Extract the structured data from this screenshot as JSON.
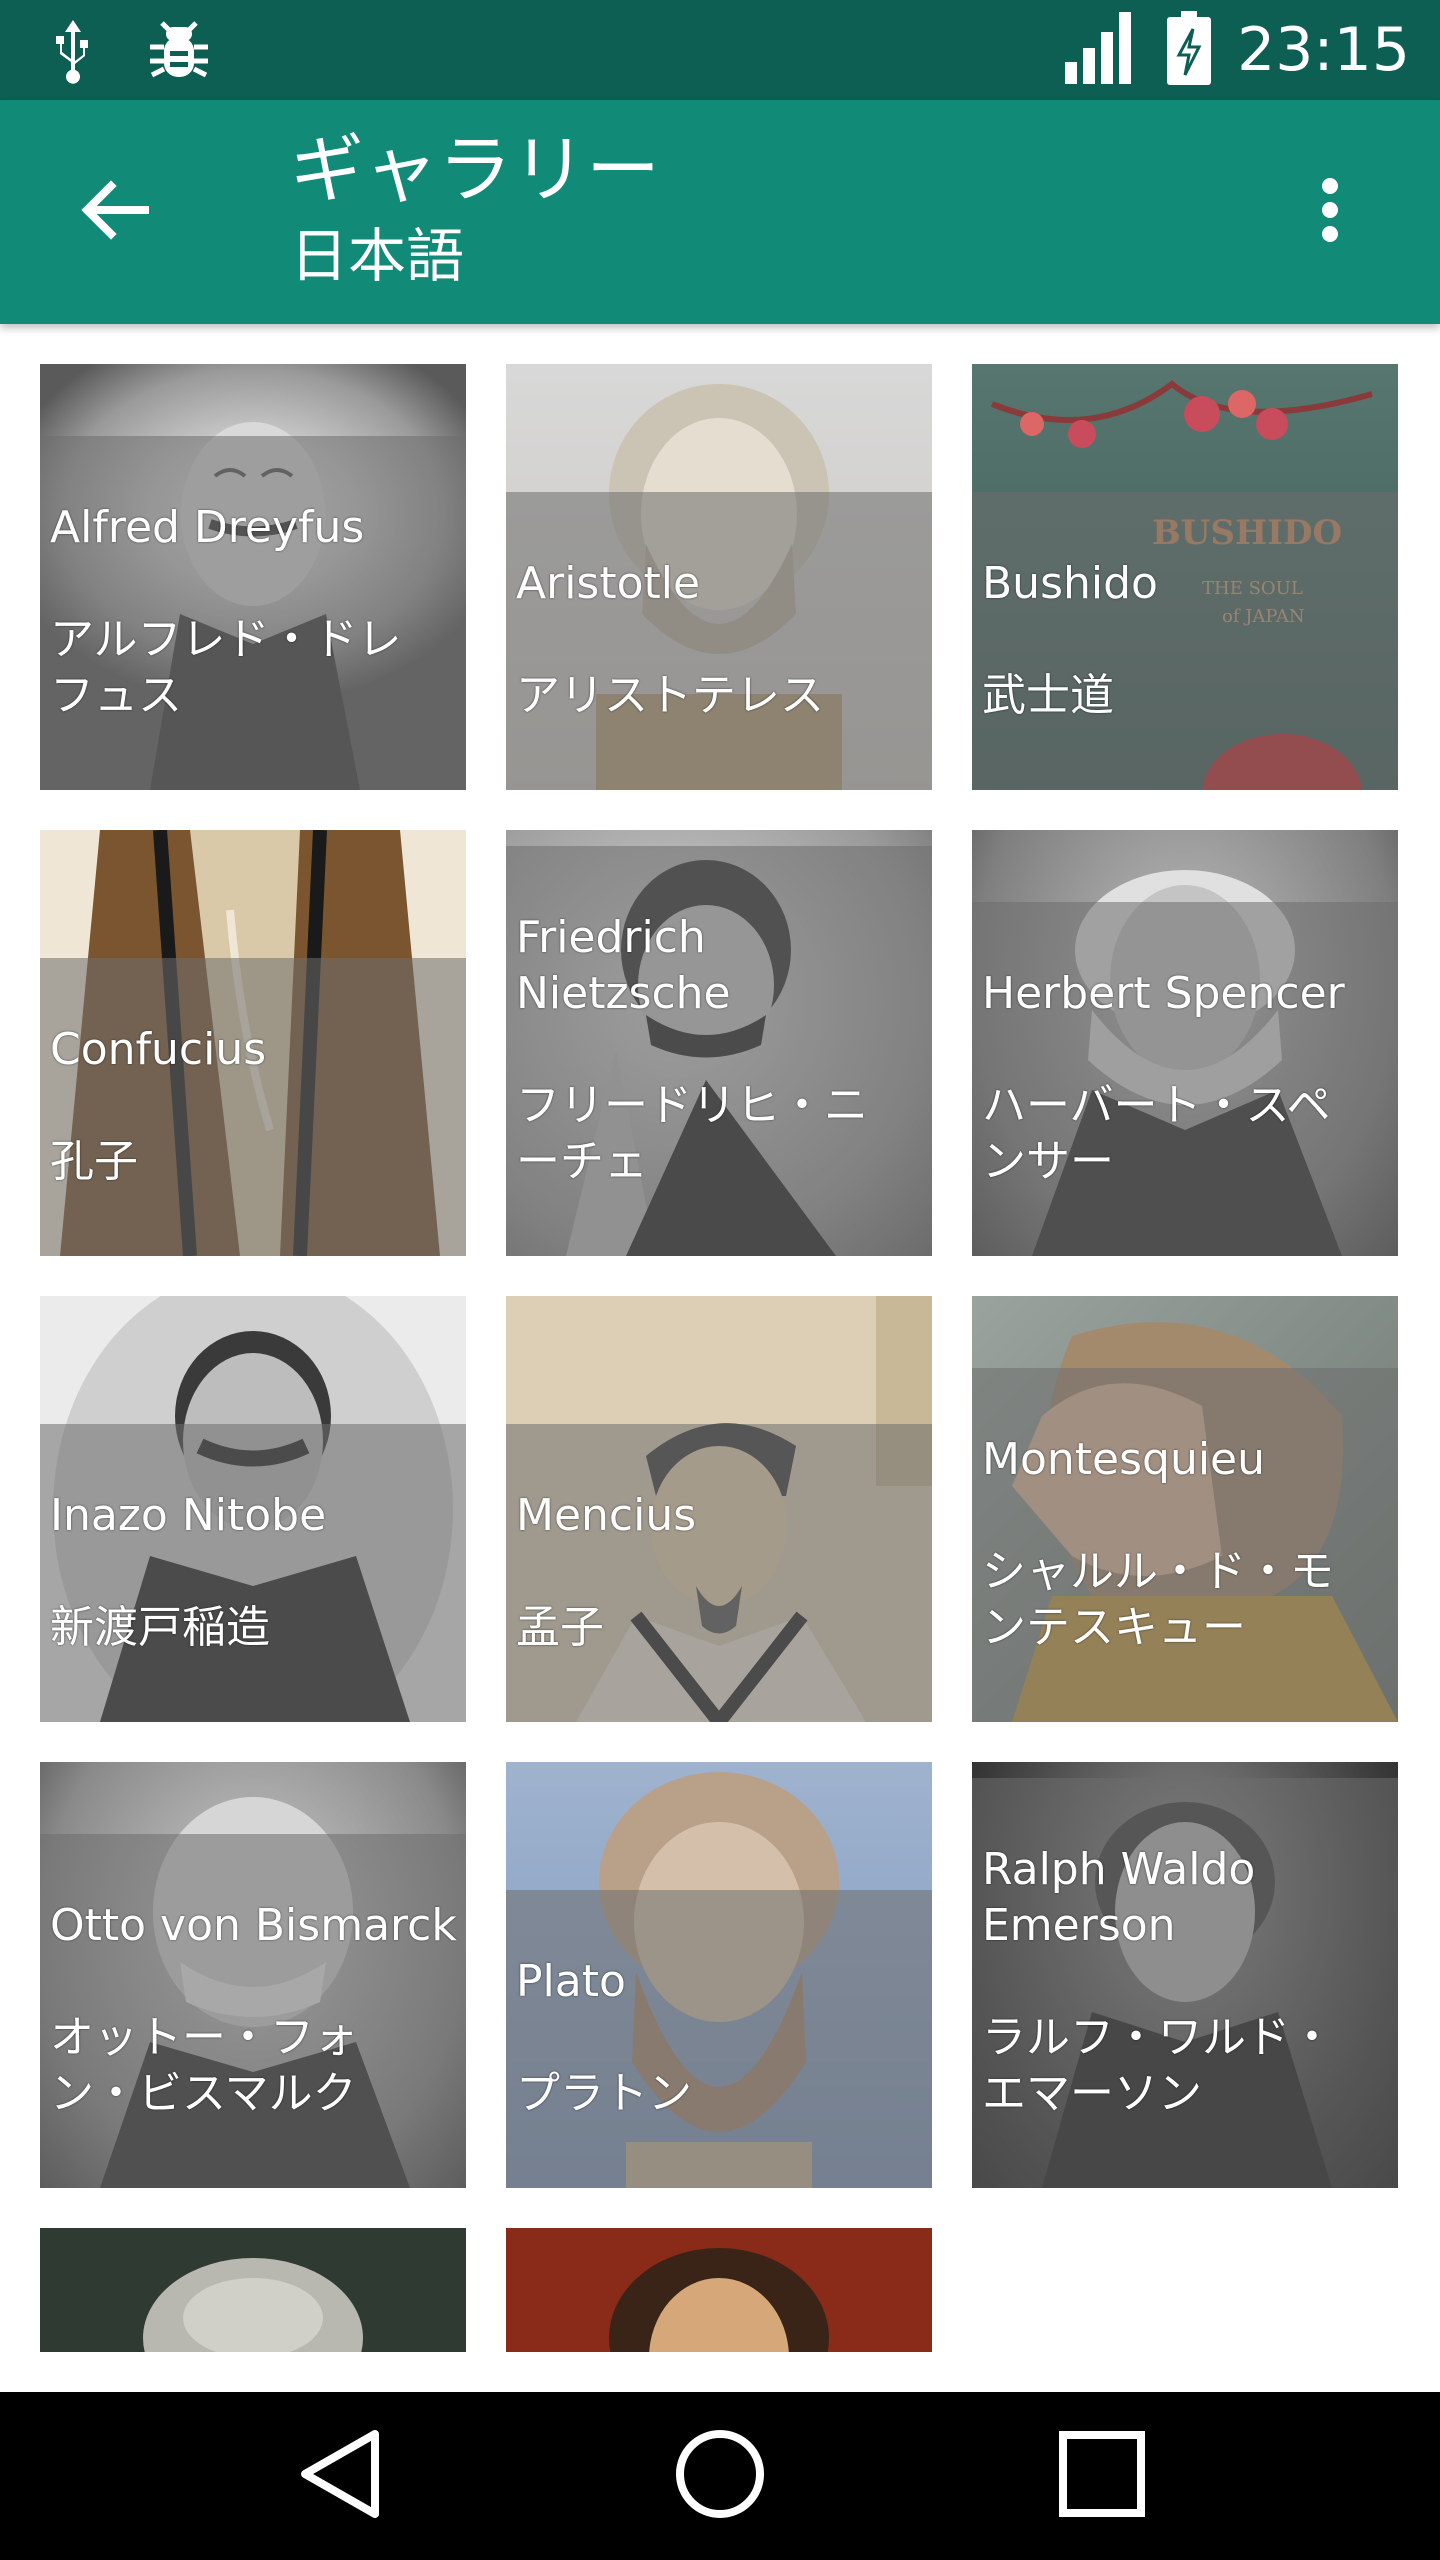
{
  "status_bar": {
    "time": "23:15",
    "left_icons": [
      "usb-icon",
      "bug-icon"
    ],
    "right_icons": [
      "signal-icon",
      "battery-charging-icon"
    ]
  },
  "app_bar": {
    "title": "ギャラリー",
    "subtitle": "日本語",
    "back_icon": "arrow-back-icon",
    "menu_icon": "more-vert-icon"
  },
  "gallery": {
    "items": [
      {
        "name_en": "Alfred Dreyfus",
        "name_ja": "アルフレド・ドレ\nフュス"
      },
      {
        "name_en": "Aristotle",
        "name_ja": "アリストテレス"
      },
      {
        "name_en": "Bushido",
        "name_ja": "武士道"
      },
      {
        "name_en": "Confucius",
        "name_ja": "孔子"
      },
      {
        "name_en": "Friedrich Nietzsche",
        "name_ja": "フリードリヒ・ニ\nーチェ"
      },
      {
        "name_en": "Herbert Spencer",
        "name_ja": "ハーバート・スペ\nンサー"
      },
      {
        "name_en": "Inazo Nitobe",
        "name_ja": "新渡戸稲造"
      },
      {
        "name_en": "Mencius",
        "name_ja": "孟子"
      },
      {
        "name_en": "Montesquieu",
        "name_ja": "シャルル・ド・モ\nンテスキュー"
      },
      {
        "name_en": "Otto von Bismarck",
        "name_ja": "オットー・フォ\nン・ビスマルク"
      },
      {
        "name_en": "Plato",
        "name_ja": "プラトン"
      },
      {
        "name_en": "Ralph Waldo\nEmerson",
        "name_ja": "ラルフ・ワルド・\nエマーソン"
      },
      {
        "name_en": "",
        "name_ja": ""
      },
      {
        "name_en": "",
        "name_ja": ""
      }
    ]
  },
  "nav_bar": {
    "icons": [
      "nav-back-icon",
      "nav-home-icon",
      "nav-recents-icon"
    ]
  },
  "colors": {
    "status_bar": "#0d5e53",
    "app_bar": "#118a78",
    "nav_bar": "#000000"
  }
}
